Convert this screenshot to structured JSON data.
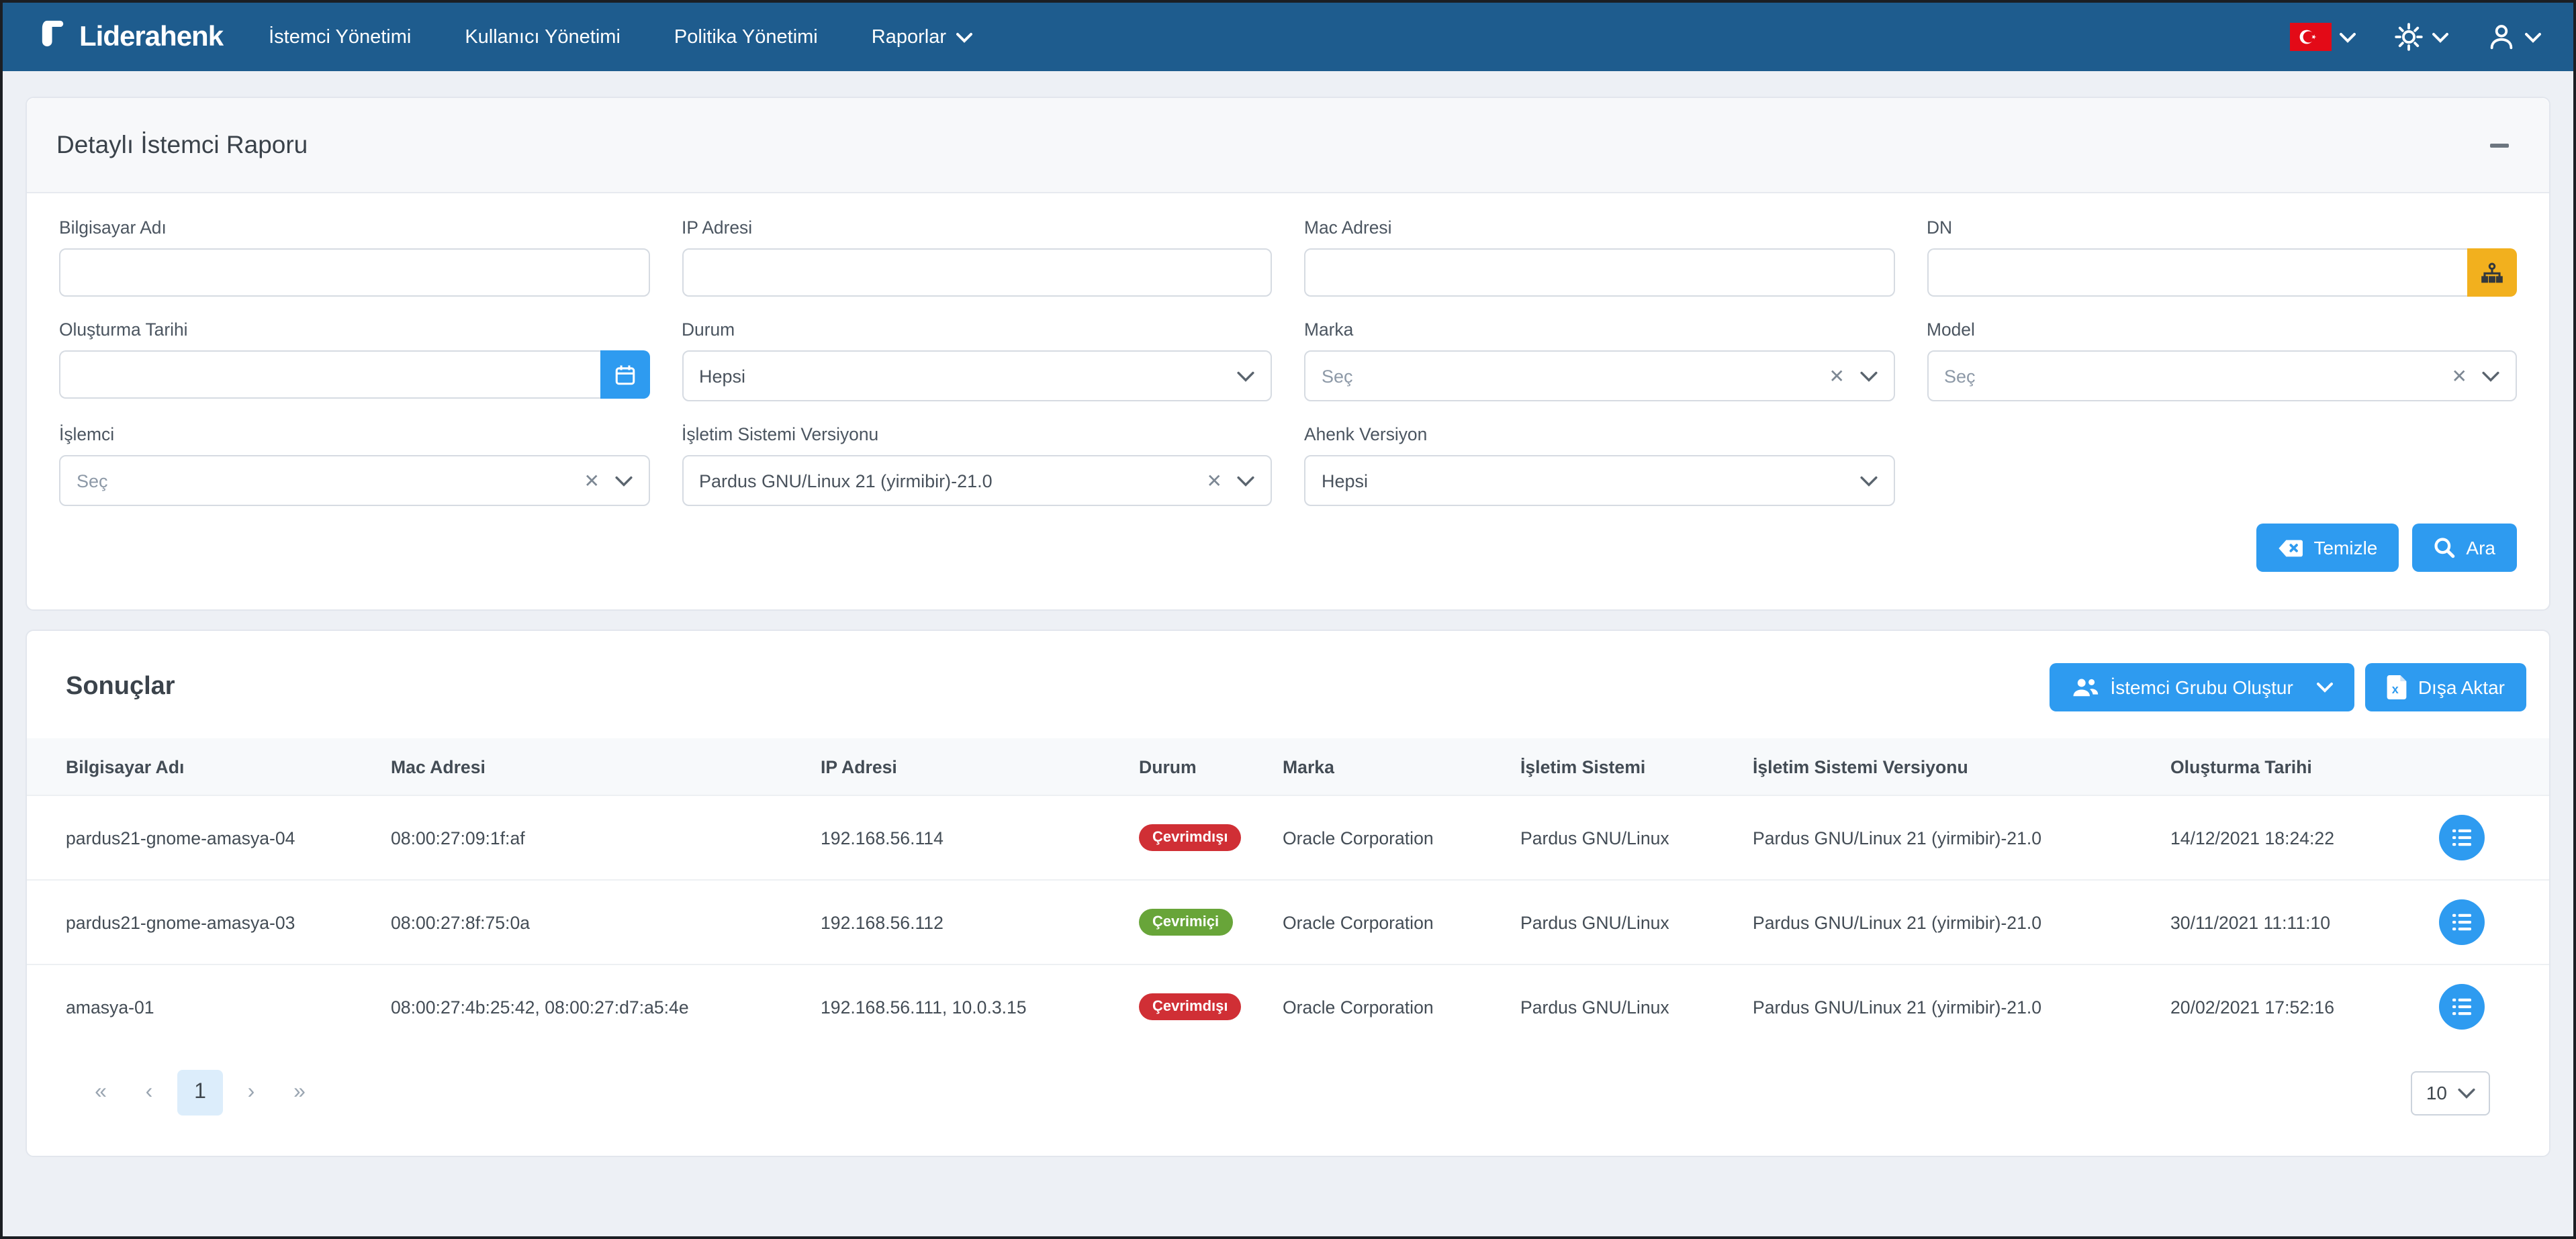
{
  "colors": {
    "navbar_bg": "#1e5c8e",
    "primary_blue": "#2e9bf0",
    "accent_orange": "#f2b01e",
    "badge_offline": "#d02f35",
    "badge_online": "#68a539",
    "page_bg": "#edf0f5"
  },
  "navbar": {
    "brand": "Liderahenk",
    "items": [
      {
        "label": "İstemci Yönetimi"
      },
      {
        "label": "Kullanıcı Yönetimi"
      },
      {
        "label": "Politika Yönetimi"
      },
      {
        "label": "Raporlar"
      }
    ]
  },
  "filter_panel": {
    "title": "Detaylı İstemci Raporu",
    "fields": {
      "bilgisayar_adi": {
        "label": "Bilgisayar Adı",
        "value": ""
      },
      "ip_adresi": {
        "label": "IP Adresi",
        "value": ""
      },
      "mac_adresi": {
        "label": "Mac Adresi",
        "value": ""
      },
      "dn": {
        "label": "DN",
        "value": ""
      },
      "olusturma_tarihi": {
        "label": "Oluşturma Tarihi",
        "value": ""
      },
      "durum": {
        "label": "Durum",
        "value": "Hepsi"
      },
      "marka": {
        "label": "Marka",
        "placeholder": "Seç"
      },
      "model": {
        "label": "Model",
        "placeholder": "Seç"
      },
      "islemci": {
        "label": "İşlemci",
        "placeholder": "Seç"
      },
      "isletim_sistemi_versiyonu": {
        "label": "İşletim Sistemi Versiyonu",
        "value": "Pardus GNU/Linux 21 (yirmibir)-21.0"
      },
      "ahenk_versiyon": {
        "label": "Ahenk Versiyon",
        "value": "Hepsi"
      }
    },
    "buttons": {
      "clear": "Temizle",
      "search": "Ara"
    }
  },
  "results": {
    "title": "Sonuçlar",
    "buttons": {
      "create_group": "İstemci Grubu Oluştur",
      "export": "Dışa Aktar"
    },
    "table": {
      "columns": [
        "Bilgisayar Adı",
        "Mac Adresi",
        "IP Adresi",
        "Durum",
        "Marka",
        "İşletim Sistemi",
        "İşletim Sistemi Versiyonu",
        "Oluşturma Tarihi"
      ],
      "rows": [
        {
          "cells": [
            "pardus21-gnome-amasya-04",
            "08:00:27:09:1f:af",
            "192.168.56.114",
            "Çevrimdışı",
            "Oracle Corporation",
            "Pardus GNU/Linux",
            "Pardus GNU/Linux 21 (yirmibir)-21.0",
            "14/12/2021 18:24:22"
          ],
          "status": "offline"
        },
        {
          "cells": [
            "pardus21-gnome-amasya-03",
            "08:00:27:8f:75:0a",
            "192.168.56.112",
            "Çevrimiçi",
            "Oracle Corporation",
            "Pardus GNU/Linux",
            "Pardus GNU/Linux 21 (yirmibir)-21.0",
            "30/11/2021 11:11:10"
          ],
          "status": "online"
        },
        {
          "cells": [
            "amasya-01",
            "08:00:27:4b:25:42, 08:00:27:d7:a5:4e",
            "192.168.56.111, 10.0.3.15",
            "Çevrimdışı",
            "Oracle Corporation",
            "Pardus GNU/Linux",
            "Pardus GNU/Linux 21 (yirmibir)-21.0",
            "20/02/2021 17:52:16"
          ],
          "status": "offline"
        }
      ]
    },
    "pagination": {
      "first": "«",
      "prev": "‹",
      "current_page": "1",
      "next": "›",
      "last": "»",
      "page_size": "10"
    }
  },
  "icons": {
    "clear_x": "✕"
  }
}
